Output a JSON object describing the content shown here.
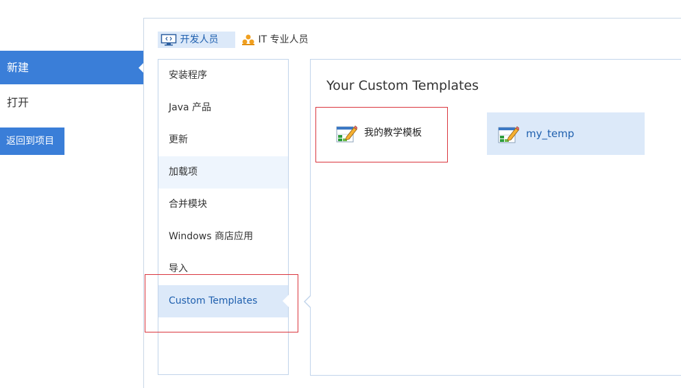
{
  "nav": {
    "items": [
      {
        "label": "新建",
        "selected": true
      },
      {
        "label": "打开",
        "selected": false
      }
    ],
    "back_label": "返回到项目"
  },
  "role_tabs": [
    {
      "label": "开发人员",
      "icon": "developer-monitor-icon",
      "active": true
    },
    {
      "label": "IT 专业人员",
      "icon": "people-group-icon",
      "active": false
    }
  ],
  "categories": [
    {
      "label": "安装程序"
    },
    {
      "label": "Java 产品"
    },
    {
      "label": "更新"
    },
    {
      "label": "加载项"
    },
    {
      "label": "合并模块"
    },
    {
      "label": "Windows 商店应用"
    },
    {
      "label": "导入"
    },
    {
      "label": "Custom Templates"
    }
  ],
  "panel": {
    "title": "Your Custom Templates",
    "templates": [
      {
        "label": "我的教学模板",
        "icon": "template-edit-icon"
      },
      {
        "label": "my_temp",
        "icon": "template-edit-icon",
        "selected": true
      }
    ]
  },
  "colors": {
    "accent": "#3a7ed8",
    "selected_bg": "#dce9f9",
    "selected_text": "#1e5fae",
    "highlight_box": "#d9323a"
  }
}
